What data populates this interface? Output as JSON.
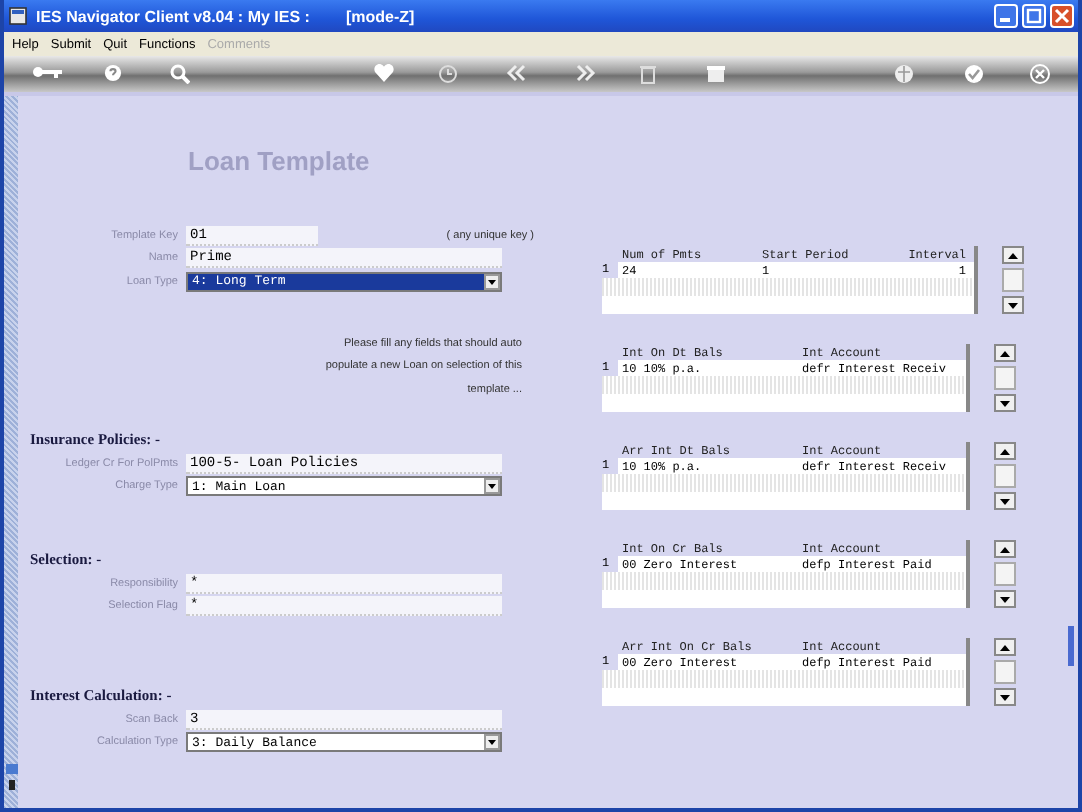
{
  "window": {
    "title": "IES Navigator Client v8.04 : My IES :",
    "mode": "[mode-Z]"
  },
  "menu": [
    {
      "label": "Help",
      "disabled": false
    },
    {
      "label": "Submit",
      "disabled": false
    },
    {
      "label": "Quit",
      "disabled": false
    },
    {
      "label": "Functions",
      "disabled": false
    },
    {
      "label": "Comments",
      "disabled": true
    }
  ],
  "page_title": "Loan Template",
  "sections": [
    {
      "fields": [
        {
          "kind": "text",
          "label": "Template Key",
          "value": "01",
          "hint": "( any unique key )"
        },
        {
          "kind": "text",
          "label": "Name",
          "value": "Prime"
        },
        {
          "kind": "select",
          "label": "Loan Type",
          "value": "4: Long Term",
          "focused": true
        }
      ],
      "note": "Please fill any fields that should auto populate a new Loan on selection of this template ..."
    },
    {
      "heading": "Insurance Policies: -",
      "fields": [
        {
          "kind": "text",
          "label": "Ledger Cr For PolPmts",
          "value": "100-5- Loan Policies"
        },
        {
          "kind": "select",
          "label": "Charge Type",
          "value": "1: Main Loan",
          "focused": false
        }
      ]
    },
    {
      "heading": "Selection: -",
      "fields": [
        {
          "kind": "text",
          "label": "Responsibility",
          "value": "*"
        },
        {
          "kind": "text",
          "label": "Selection Flag",
          "value": "*"
        }
      ]
    },
    {
      "heading": "Interest Calculation: -",
      "fields": [
        {
          "kind": "text",
          "label": "Scan Back",
          "value": "3"
        },
        {
          "kind": "select",
          "label": "Calculation Type",
          "value": "3: Daily Balance",
          "focused": false
        }
      ]
    }
  ],
  "grids": [
    {
      "columns": [
        "Num of Pmts",
        "Start Period",
        "Interval"
      ],
      "rows": [
        {
          "num": "1",
          "cells": [
            "24",
            "1",
            "1"
          ]
        }
      ]
    },
    {
      "columns": [
        "Int On Dt Bals",
        "Int Account"
      ],
      "rows": [
        {
          "num": "1",
          "cells": [
            "10 10% p.a.",
            "defr Interest Receiv"
          ]
        }
      ]
    },
    {
      "columns": [
        "Arr Int Dt Bals",
        "Int Account"
      ],
      "rows": [
        {
          "num": "1",
          "cells": [
            "10 10% p.a.",
            "defr Interest Receiv"
          ]
        }
      ]
    },
    {
      "columns": [
        "Int On Cr Bals",
        "Int Account"
      ],
      "rows": [
        {
          "num": "1",
          "cells": [
            "00 Zero Interest",
            "defp Interest Paid"
          ]
        }
      ]
    },
    {
      "columns": [
        "Arr Int On Cr Bals",
        "Int Account"
      ],
      "rows": [
        {
          "num": "1",
          "cells": [
            "00 Zero Interest",
            "defp Interest Paid"
          ]
        }
      ]
    }
  ]
}
